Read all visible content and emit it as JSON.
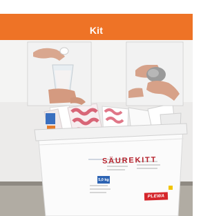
{
  "header": {
    "title": "Kit"
  },
  "product": {
    "label_title": "SÄUREKITT",
    "weight": "5,0 kg",
    "brand": "PLEWA"
  },
  "colors": {
    "header_bg": "#ee7326",
    "header_text": "#ffffff",
    "label_red": "#b51f2a",
    "weight_tag": "#2c63b3",
    "brand_red": "#d5262b"
  },
  "icons": [
    "hand-pouring-photo",
    "hand-mixing-photo",
    "product-bucket-photo"
  ]
}
